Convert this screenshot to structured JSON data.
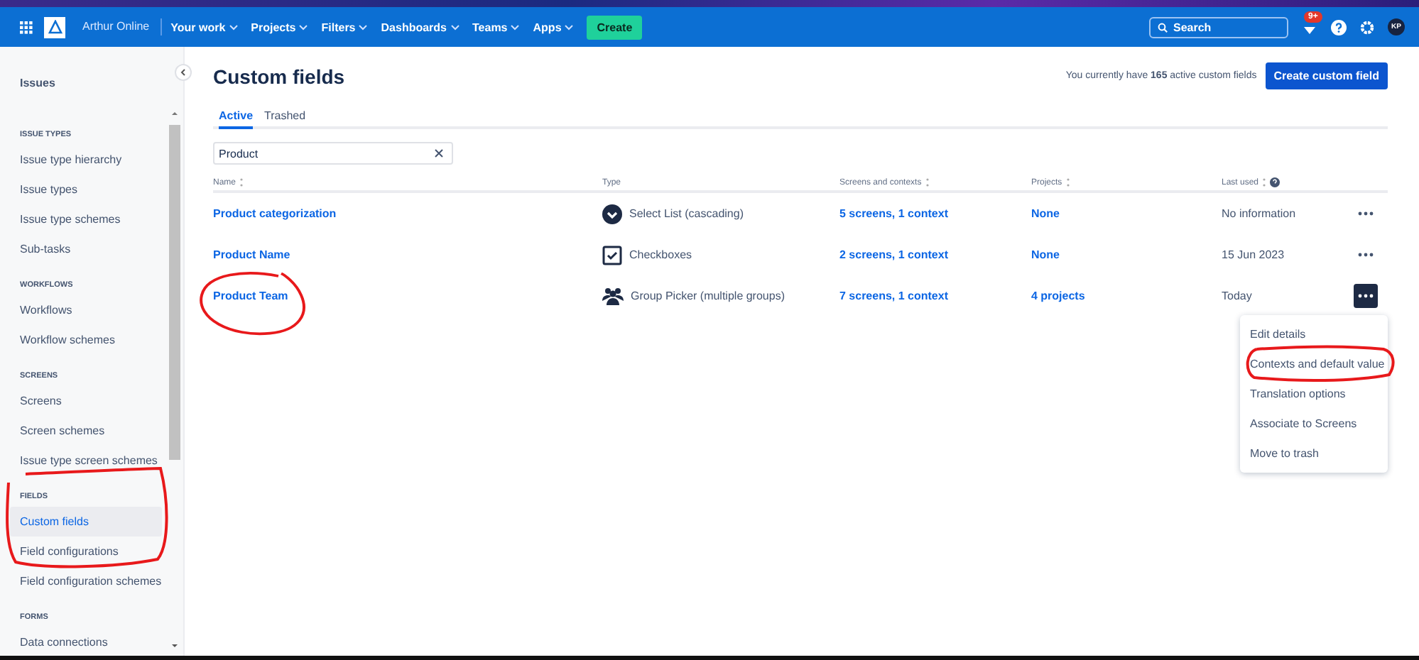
{
  "nav": {
    "site": "Arthur Online",
    "menus": [
      {
        "label": "Your work"
      },
      {
        "label": "Projects"
      },
      {
        "label": "Filters"
      },
      {
        "label": "Dashboards"
      },
      {
        "label": "Teams"
      },
      {
        "label": "Apps"
      }
    ],
    "create": "Create",
    "search": {
      "placeholder": "Search"
    },
    "notifications": "9+",
    "avatar": "KP"
  },
  "sidebar": {
    "title": "Issues",
    "sections": [
      {
        "heading": "ISSUE TYPES",
        "items": [
          {
            "label": "Issue type hierarchy",
            "selected": false
          },
          {
            "label": "Issue types",
            "selected": false
          },
          {
            "label": "Issue type schemes",
            "selected": false
          },
          {
            "label": "Sub-tasks",
            "selected": false
          }
        ]
      },
      {
        "heading": "WORKFLOWS",
        "items": [
          {
            "label": "Workflows",
            "selected": false
          },
          {
            "label": "Workflow schemes",
            "selected": false
          }
        ]
      },
      {
        "heading": "SCREENS",
        "items": [
          {
            "label": "Screens",
            "selected": false
          },
          {
            "label": "Screen schemes",
            "selected": false
          },
          {
            "label": "Issue type screen schemes",
            "selected": false
          }
        ]
      },
      {
        "heading": "FIELDS",
        "items": [
          {
            "label": "Custom fields",
            "selected": true
          },
          {
            "label": "Field configurations",
            "selected": false
          },
          {
            "label": "Field configuration schemes",
            "selected": false
          }
        ]
      },
      {
        "heading": "FORMS",
        "items": [
          {
            "label": "Data connections",
            "selected": false
          }
        ]
      }
    ]
  },
  "page": {
    "title": "Custom fields",
    "summary": "You currently have **165** active custom fields",
    "create_button": "Create custom field",
    "tabs": [
      {
        "label": "Active",
        "selected": true
      },
      {
        "label": "Trashed",
        "selected": false
      }
    ],
    "filter": {
      "value": "Product"
    }
  },
  "table": {
    "columns": [
      {
        "label": "Name",
        "sortable": true,
        "help": false
      },
      {
        "label": "Type",
        "sortable": false,
        "help": false
      },
      {
        "label": "Screens and contexts",
        "sortable": true,
        "help": false
      },
      {
        "label": "Projects",
        "sortable": true,
        "help": false
      },
      {
        "label": "Last used",
        "sortable": true,
        "help": true
      }
    ],
    "rows": [
      {
        "name": "Product categorization",
        "type": "Select List (cascading)",
        "kind": "select",
        "screens": "5 screens, 1 context",
        "projects": "None",
        "last_used": "No information",
        "menu_open": false
      },
      {
        "name": "Product Name",
        "type": "Checkboxes",
        "kind": "checkbox",
        "screens": "2 screens, 1 context",
        "projects": "None",
        "last_used": "15 Jun 2023",
        "menu_open": false
      },
      {
        "name": "Product Team",
        "type": "Group Picker (multiple groups)",
        "kind": "group",
        "screens": "7 screens, 1 context",
        "projects": "4 projects",
        "last_used": "Today",
        "menu_open": true
      }
    ]
  },
  "row_menu": {
    "items": [
      {
        "label": "Edit details"
      },
      {
        "label": "Contexts and default value"
      },
      {
        "label": "Translation options"
      },
      {
        "label": "Associate to Screens"
      },
      {
        "label": "Move to trash"
      }
    ]
  }
}
